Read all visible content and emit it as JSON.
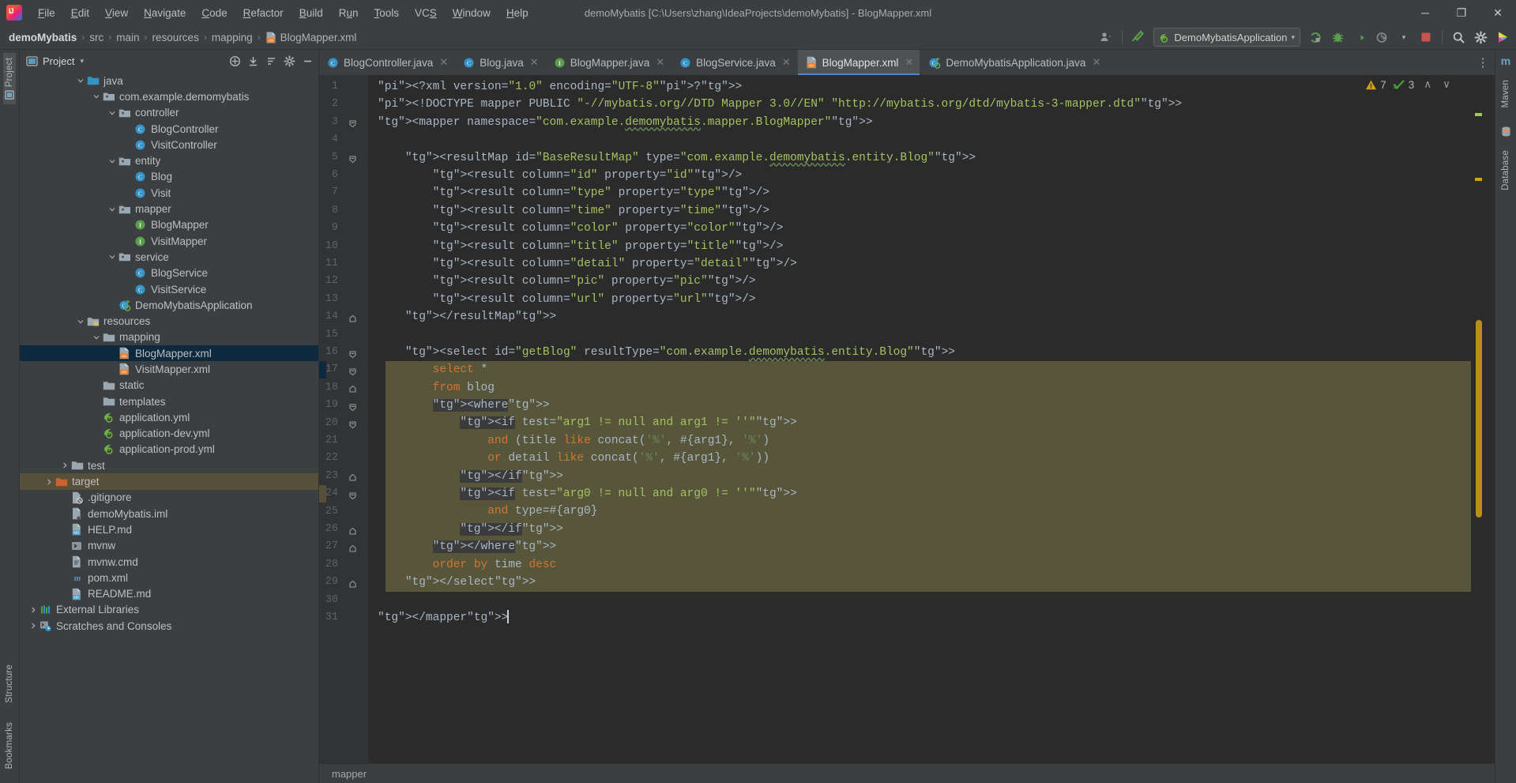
{
  "window": {
    "title": "demoMybatis [C:\\Users\\zhang\\IdeaProjects\\demoMybatis] - BlogMapper.xml",
    "minimize_label": "─",
    "maximize_label": "❐",
    "close_label": "✕"
  },
  "menu": [
    {
      "label": "File"
    },
    {
      "label": "Edit"
    },
    {
      "label": "View"
    },
    {
      "label": "Navigate"
    },
    {
      "label": "Code"
    },
    {
      "label": "Refactor"
    },
    {
      "label": "Build"
    },
    {
      "label": "Run"
    },
    {
      "label": "Tools"
    },
    {
      "label": "VCS"
    },
    {
      "label": "Window"
    },
    {
      "label": "Help"
    }
  ],
  "breadcrumb": {
    "separator": "›",
    "items": [
      {
        "label": "demoMybatis",
        "icon": "none"
      },
      {
        "label": "src",
        "icon": "none"
      },
      {
        "label": "main",
        "icon": "none"
      },
      {
        "label": "resources",
        "icon": "none"
      },
      {
        "label": "mapping",
        "icon": "none"
      },
      {
        "label": "BlogMapper.xml",
        "icon": "xml-file-icon"
      }
    ]
  },
  "toolbar": {
    "run_config": "DemoMybatisApplication",
    "run_config_caret": "▾",
    "icons": [
      {
        "name": "profile-icon"
      },
      {
        "name": "build-hammer-icon"
      },
      {
        "name": "run-icon"
      },
      {
        "name": "debug-icon"
      },
      {
        "name": "run-coverage-icon"
      },
      {
        "name": "profiler-icon"
      },
      {
        "name": "stop-icon"
      },
      {
        "name": "search-everywhere-icon"
      },
      {
        "name": "settings-gear-icon"
      },
      {
        "name": "updates-icon"
      }
    ]
  },
  "left_strip": {
    "top_label": "Project",
    "bottom_labels": [
      "Structure",
      "Bookmarks"
    ]
  },
  "right_strip": {
    "labels": [
      "Maven",
      "Database"
    ]
  },
  "project_panel": {
    "title": "Project",
    "title_caret": "▾",
    "header_icons": [
      {
        "name": "expand-all-icon"
      },
      {
        "name": "collapse-all-icon"
      },
      {
        "name": "sort-icon"
      },
      {
        "name": "settings-icon"
      },
      {
        "name": "hide-icon"
      }
    ],
    "tree": [
      {
        "label": "java",
        "indent": 3,
        "arrow": "down",
        "icon": "folder-source-icon",
        "state": "normal"
      },
      {
        "label": "com.example.demomybatis",
        "indent": 4,
        "arrow": "down",
        "icon": "package-icon",
        "state": "normal"
      },
      {
        "label": "controller",
        "indent": 5,
        "arrow": "down",
        "icon": "package-icon",
        "state": "normal"
      },
      {
        "label": "BlogController",
        "indent": 6,
        "arrow": "none",
        "icon": "class-icon",
        "state": "normal"
      },
      {
        "label": "VisitController",
        "indent": 6,
        "arrow": "none",
        "icon": "class-icon",
        "state": "normal"
      },
      {
        "label": "entity",
        "indent": 5,
        "arrow": "down",
        "icon": "package-icon",
        "state": "normal"
      },
      {
        "label": "Blog",
        "indent": 6,
        "arrow": "none",
        "icon": "class-icon",
        "state": "normal"
      },
      {
        "label": "Visit",
        "indent": 6,
        "arrow": "none",
        "icon": "class-icon",
        "state": "normal"
      },
      {
        "label": "mapper",
        "indent": 5,
        "arrow": "down",
        "icon": "package-icon",
        "state": "normal"
      },
      {
        "label": "BlogMapper",
        "indent": 6,
        "arrow": "none",
        "icon": "interface-icon",
        "state": "normal"
      },
      {
        "label": "VisitMapper",
        "indent": 6,
        "arrow": "none",
        "icon": "interface-icon",
        "state": "normal"
      },
      {
        "label": "service",
        "indent": 5,
        "arrow": "down",
        "icon": "package-icon",
        "state": "normal"
      },
      {
        "label": "BlogService",
        "indent": 6,
        "arrow": "none",
        "icon": "class-icon",
        "state": "normal"
      },
      {
        "label": "VisitService",
        "indent": 6,
        "arrow": "none",
        "icon": "class-icon",
        "state": "normal"
      },
      {
        "label": "DemoMybatisApplication",
        "indent": 5,
        "arrow": "none",
        "icon": "spring-class-icon",
        "state": "normal"
      },
      {
        "label": "resources",
        "indent": 3,
        "arrow": "down",
        "icon": "folder-resource-icon",
        "state": "normal"
      },
      {
        "label": "mapping",
        "indent": 4,
        "arrow": "down",
        "icon": "folder-icon",
        "state": "normal"
      },
      {
        "label": "BlogMapper.xml",
        "indent": 5,
        "arrow": "none",
        "icon": "xml-file-icon",
        "state": "selected"
      },
      {
        "label": "VisitMapper.xml",
        "indent": 5,
        "arrow": "none",
        "icon": "xml-file-icon",
        "state": "normal"
      },
      {
        "label": "static",
        "indent": 4,
        "arrow": "none",
        "icon": "folder-icon",
        "state": "normal"
      },
      {
        "label": "templates",
        "indent": 4,
        "arrow": "none",
        "icon": "folder-icon",
        "state": "normal"
      },
      {
        "label": "application.yml",
        "indent": 4,
        "arrow": "none",
        "icon": "spring-yml-icon",
        "state": "normal"
      },
      {
        "label": "application-dev.yml",
        "indent": 4,
        "arrow": "none",
        "icon": "spring-yml-icon",
        "state": "normal"
      },
      {
        "label": "application-prod.yml",
        "indent": 4,
        "arrow": "none",
        "icon": "spring-yml-icon",
        "state": "normal"
      },
      {
        "label": "test",
        "indent": 2,
        "arrow": "right",
        "icon": "folder-icon",
        "state": "normal"
      },
      {
        "label": "target",
        "indent": 1,
        "arrow": "right",
        "icon": "folder-excluded-icon",
        "state": "marked"
      },
      {
        "label": ".gitignore",
        "indent": 2,
        "arrow": "none",
        "icon": "gitignore-icon",
        "state": "normal"
      },
      {
        "label": "demoMybatis.iml",
        "indent": 2,
        "arrow": "none",
        "icon": "iml-file-icon",
        "state": "normal"
      },
      {
        "label": "HELP.md",
        "indent": 2,
        "arrow": "none",
        "icon": "markdown-icon",
        "state": "normal"
      },
      {
        "label": "mvnw",
        "indent": 2,
        "arrow": "none",
        "icon": "shell-script-icon",
        "state": "normal"
      },
      {
        "label": "mvnw.cmd",
        "indent": 2,
        "arrow": "none",
        "icon": "cmd-file-icon",
        "state": "normal"
      },
      {
        "label": "pom.xml",
        "indent": 2,
        "arrow": "none",
        "icon": "maven-icon",
        "state": "normal"
      },
      {
        "label": "README.md",
        "indent": 2,
        "arrow": "none",
        "icon": "markdown-icon",
        "state": "normal"
      },
      {
        "label": "External Libraries",
        "indent": 0,
        "arrow": "right",
        "icon": "libraries-icon",
        "state": "normal"
      },
      {
        "label": "Scratches and Consoles",
        "indent": 0,
        "arrow": "right",
        "icon": "scratches-icon",
        "state": "normal"
      }
    ]
  },
  "editor_tabs": [
    {
      "label": "BlogController.java",
      "icon": "java-class-icon",
      "active": false
    },
    {
      "label": "Blog.java",
      "icon": "java-class-icon",
      "active": false
    },
    {
      "label": "BlogMapper.java",
      "icon": "java-interface-icon",
      "active": false
    },
    {
      "label": "BlogService.java",
      "icon": "java-class-icon",
      "active": false
    },
    {
      "label": "BlogMapper.xml",
      "icon": "xml-file-icon",
      "active": true
    },
    {
      "label": "DemoMybatisApplication.java",
      "icon": "spring-class-icon",
      "active": false
    }
  ],
  "editor_tabs_close": "✕",
  "editor_tabs_overflow": "⋮",
  "inspection": {
    "warning_count": "7",
    "weak_warning_count": "3",
    "prev_label": "∧",
    "next_label": "∨"
  },
  "code": {
    "filename": "BlogMapper.xml",
    "first_line": 1,
    "line_count": 31,
    "lines": [
      "<?xml version=\"1.0\" encoding=\"UTF-8\"?>",
      "<!DOCTYPE mapper PUBLIC \"-//mybatis.org//DTD Mapper 3.0//EN\" \"http://mybatis.org/dtd/mybatis-3-mapper.dtd\">",
      "<mapper namespace=\"com.example.demomybatis.mapper.BlogMapper\">",
      "",
      "    <resultMap id=\"BaseResultMap\" type=\"com.example.demomybatis.entity.Blog\">",
      "        <result column=\"id\" property=\"id\"/>",
      "        <result column=\"type\" property=\"type\"/>",
      "        <result column=\"time\" property=\"time\"/>",
      "        <result column=\"color\" property=\"color\"/>",
      "        <result column=\"title\" property=\"title\"/>",
      "        <result column=\"detail\" property=\"detail\"/>",
      "        <result column=\"pic\" property=\"pic\"/>",
      "        <result column=\"url\" property=\"url\"/>",
      "    </resultMap>",
      "",
      "    <select id=\"getBlog\" resultType=\"com.example.demomybatis.entity.Blog\">",
      "        select *",
      "        from blog",
      "        <where>",
      "            <if test=\"arg1 != null and arg1 != ''\">",
      "                and (title like concat('%', #{arg1}, '%')",
      "                or detail like concat('%', #{arg1}, '%'))",
      "            </if>",
      "            <if test=\"arg0 != null and arg0 != ''\">",
      "                and type=#{arg0}",
      "            </if>",
      "        </where>",
      "        order by time desc",
      "    </select>",
      "",
      "</mapper>"
    ]
  },
  "editor_breadcrumb": "mapper",
  "colors": {
    "panel_bg": "#3c3f41",
    "editor_bg": "#2b2b2b",
    "gutter_bg": "#313335",
    "selection": "#0d293e",
    "sql_injection": "#58563a",
    "tag_color": "#e8bf6a",
    "attr_value": "#a5c261",
    "keyword": "#cc7832",
    "accent": "#4a88c7",
    "warning": "#d4a017",
    "marked_row": "#56503b"
  }
}
